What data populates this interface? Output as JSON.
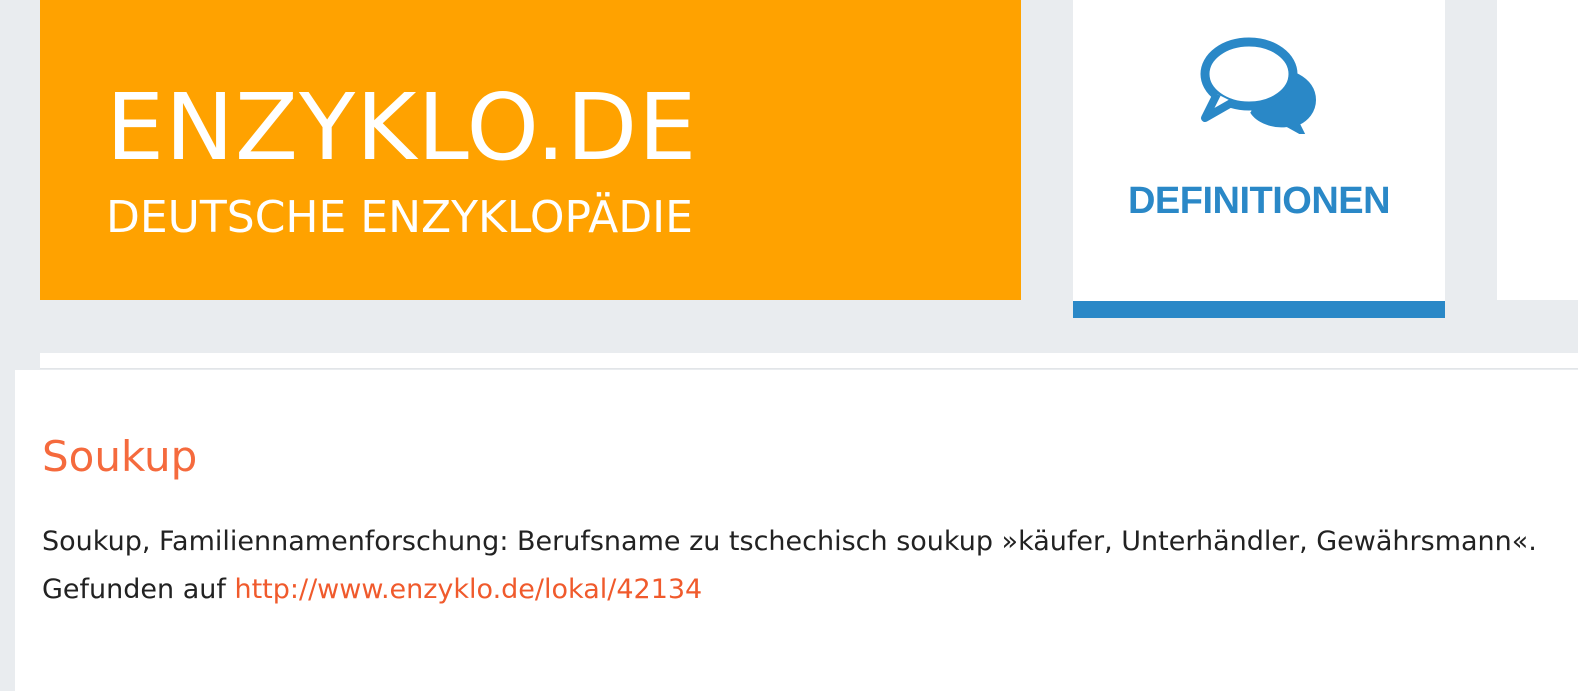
{
  "brand": {
    "name": "ENZYKLO.DE",
    "tagline": "DEUTSCHE ENZYKLOPÄDIE",
    "color": "#ffa200"
  },
  "nav": {
    "active": {
      "label": "DEFINITIONEN",
      "icon": "speech-bubbles-icon",
      "color": "#2a88c7"
    }
  },
  "entry": {
    "title": "Soukup",
    "definition": "Soukup, Familiennamenforschung: Berufsname zu tschechisch soukup »käufer, Unterhändler, Gewährsmann«.",
    "source_prefix": "Gefunden auf",
    "source_link": "http://www.enzyklo.de/lokal/42134",
    "title_color": "#f56a3d"
  }
}
